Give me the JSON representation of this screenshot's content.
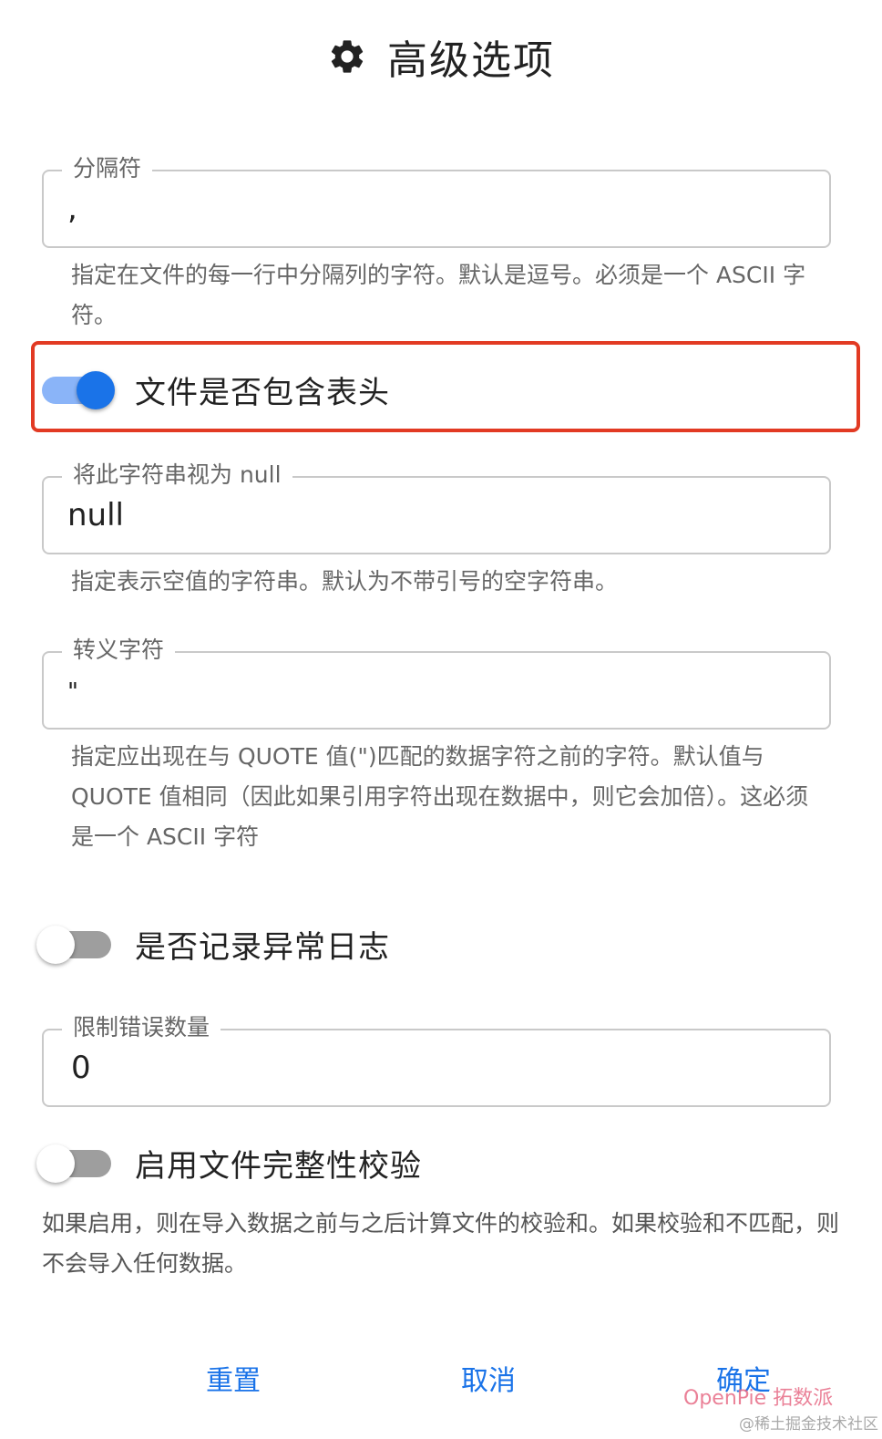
{
  "dialog": {
    "title": "高级选项",
    "title_icon": "gear-icon"
  },
  "delimiter": {
    "label": "分隔符",
    "value": ",",
    "helper": "指定在文件的每一行中分隔列的字符。默认是逗号。必须是一个 ASCII 字符。"
  },
  "header_toggle": {
    "label": "文件是否包含表头",
    "on": true
  },
  "null_string": {
    "label": "将此字符串视为 null",
    "value": "null",
    "helper": "指定表示空值的字符串。默认为不带引号的空字符串。"
  },
  "escape_char": {
    "label": "转义字符",
    "value": "\"",
    "helper": "指定应出现在与 QUOTE 值(\")匹配的数据字符之前的字符。默认值与 QUOTE 值相同（因此如果引用字符出现在数据中，则它会加倍）。这必须是一个 ASCII 字符"
  },
  "log_errors_toggle": {
    "label": "是否记录异常日志",
    "on": false
  },
  "error_limit": {
    "label": "限制错误数量",
    "value": "0"
  },
  "checksum_toggle": {
    "label": "启用文件完整性校验",
    "on": false,
    "helper": "如果启用，则在导入数据之前与之后计算文件的校验和。如果校验和不匹配，则不会导入任何数据。"
  },
  "buttons": {
    "reset": "重置",
    "cancel": "取消",
    "confirm": "确定"
  },
  "watermark": {
    "brand": "OpenPie 拓数派",
    "community": "@稀土掘金技术社区"
  },
  "colors": {
    "accent": "#1a73e8",
    "highlight": "#e23a23"
  }
}
